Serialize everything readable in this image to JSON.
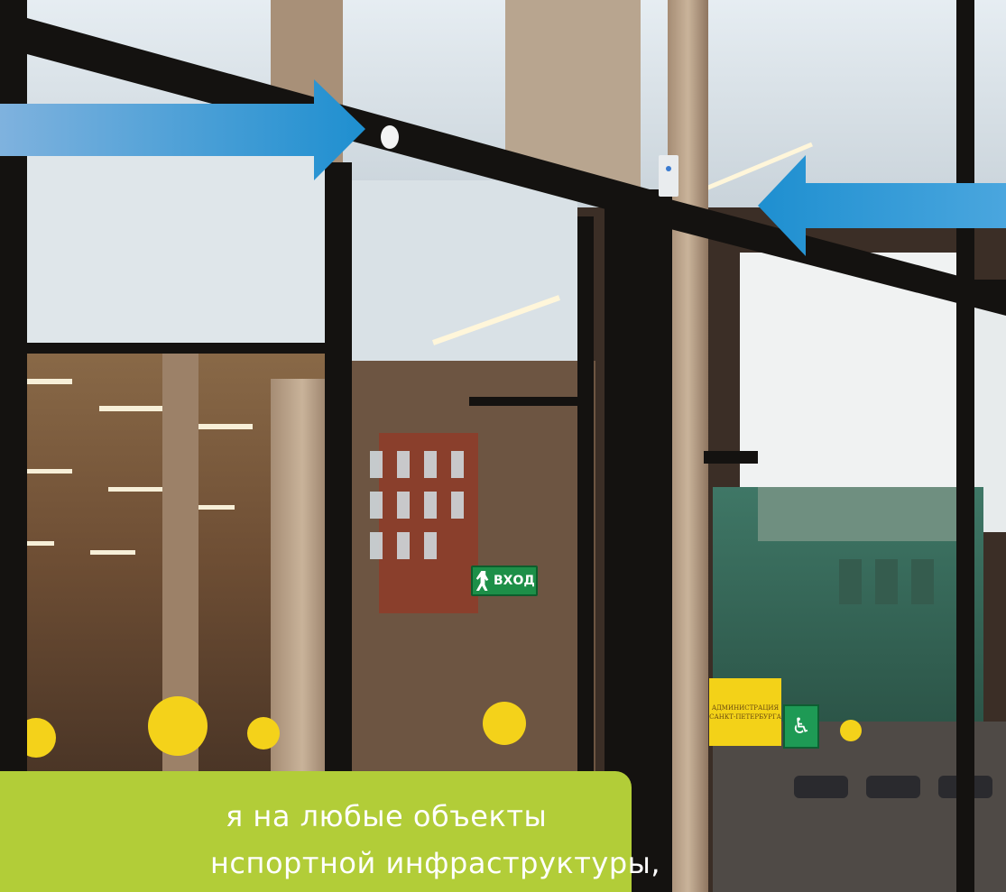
{
  "caption": {
    "line1": "я на любые объекты",
    "line2": "нспортной  инфраструктуры,",
    "background": "#b2cd38"
  },
  "signs": {
    "exit_label": "ВХОД",
    "admin_line1": "АДМИНИСТРАЦИЯ",
    "admin_line2": "САНКТ-ПЕТЕРБУРГА",
    "access_icon": "wheelchair-icon"
  },
  "arrows": {
    "color": "#1e8fd0",
    "left_direction": "right",
    "right_direction": "left"
  }
}
